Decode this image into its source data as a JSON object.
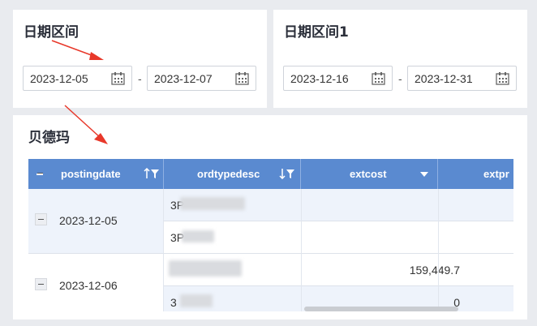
{
  "filters": [
    {
      "title": "日期区间",
      "start": "2023-12-05",
      "end": "2023-12-07",
      "separator": "-"
    },
    {
      "title": "日期区间1",
      "start": "2023-12-16",
      "end": "2023-12-31",
      "separator": "-"
    }
  ],
  "table_card": {
    "title": "贝德玛",
    "columns": [
      {
        "label": "postingdate",
        "icon": "sort-filter-icon"
      },
      {
        "label": "ordtypedesc",
        "icon": "sort-desc-filter-icon"
      },
      {
        "label": "extcost",
        "icon": "dropdown-caret-icon"
      },
      {
        "label": "extpr",
        "icon": ""
      }
    ],
    "groups": [
      {
        "date": "2023-12-05",
        "rows": [
          {
            "ordtype": "3P",
            "extcost": ""
          },
          {
            "ordtype": "3P",
            "extcost": ""
          }
        ]
      },
      {
        "date": "2023-12-06",
        "rows": [
          {
            "ordtype": "",
            "extcost": "159,449.7"
          },
          {
            "ordtype": "3",
            "extcost": "0"
          }
        ]
      }
    ]
  },
  "colors": {
    "header": "#5a8ad0",
    "row_alt": "#eef3fb",
    "annotation": "#e8382a"
  }
}
